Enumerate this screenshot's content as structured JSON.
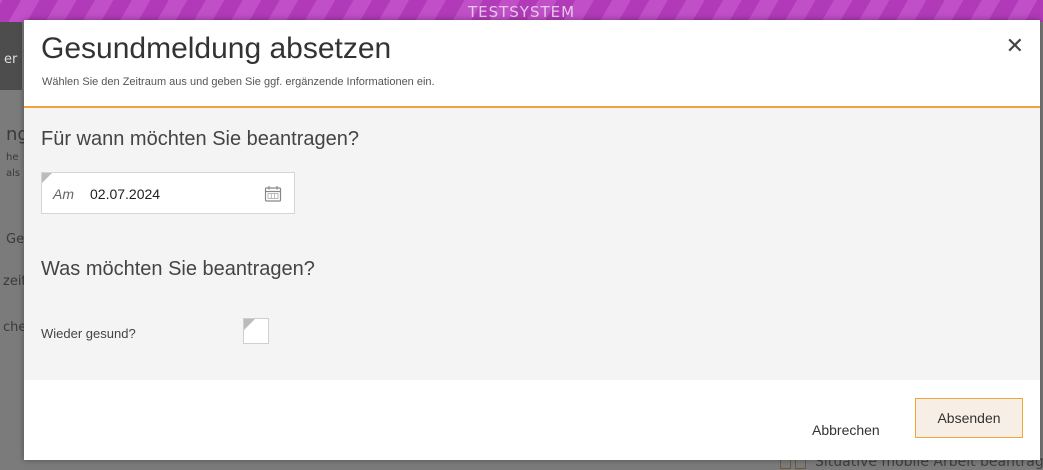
{
  "banner": {
    "label": "TESTSYSTEM"
  },
  "background": {
    "fragments": [
      "er",
      "ng",
      "he",
      "als",
      "Ge",
      "zeit",
      "che"
    ],
    "bottom_text": "Situative mobile Arbeit beantrage"
  },
  "dialog": {
    "title": "Gesundmeldung absetzen",
    "subtitle": "Wählen Sie den Zeitraum aus und geben Sie ggf. ergänzende Informationen ein.",
    "close_icon": "close-icon",
    "section_when": "Für wann möchten Sie beantragen?",
    "date_prefix": "Am",
    "date_value": "02.07.2024",
    "calendar_icon": "calendar-icon",
    "section_what": "Was möchten Sie beantragen?",
    "checkbox_label": "Wieder gesund?",
    "checkbox_checked": false,
    "cancel_label": "Abbrechen",
    "submit_label": "Absenden"
  },
  "colors": {
    "banner": "#b13ab8",
    "accent": "#f0a43a",
    "body_bg": "#f4f4f4"
  }
}
